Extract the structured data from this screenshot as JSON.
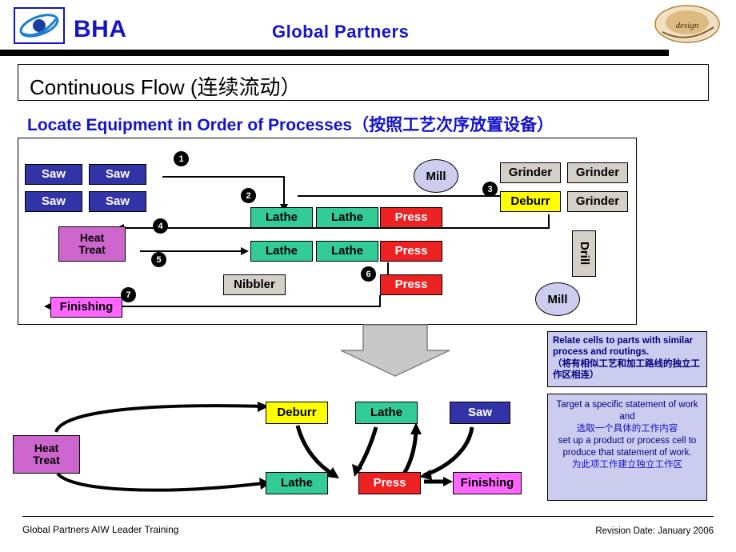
{
  "header": {
    "brand": "BHA",
    "center_title": "Global Partners",
    "logo_icon": "swoosh-logo-icon",
    "right_logo_icon": "company-seal-icon"
  },
  "title": "Continuous Flow (连续流动）",
  "subtitle": "Locate Equipment in Order of Processes（按照工艺次序放置设备）",
  "top_diagram": {
    "nodes": [
      {
        "id": "saw1",
        "label": "Saw",
        "type": "saw"
      },
      {
        "id": "saw2",
        "label": "Saw",
        "type": "saw"
      },
      {
        "id": "saw3",
        "label": "Saw",
        "type": "saw"
      },
      {
        "id": "saw4",
        "label": "Saw",
        "type": "saw"
      },
      {
        "id": "lathe1",
        "label": "Lathe",
        "type": "lathe"
      },
      {
        "id": "lathe2",
        "label": "Lathe",
        "type": "lathe"
      },
      {
        "id": "lathe3",
        "label": "Lathe",
        "type": "lathe"
      },
      {
        "id": "lathe4",
        "label": "Lathe",
        "type": "lathe"
      },
      {
        "id": "press1",
        "label": "Press",
        "type": "press"
      },
      {
        "id": "press2",
        "label": "Press",
        "type": "press"
      },
      {
        "id": "press3",
        "label": "Press",
        "type": "press"
      },
      {
        "id": "mill1",
        "label": "Mill",
        "type": "mill"
      },
      {
        "id": "mill2",
        "label": "Mill",
        "type": "mill"
      },
      {
        "id": "grinder1",
        "label": "Grinder",
        "type": "grinder"
      },
      {
        "id": "grinder2",
        "label": "Grinder",
        "type": "grinder"
      },
      {
        "id": "grinder3",
        "label": "Grinder",
        "type": "grinder"
      },
      {
        "id": "deburr",
        "label": "Deburr",
        "type": "deburr"
      },
      {
        "id": "drill",
        "label": "Drill",
        "type": "drill"
      },
      {
        "id": "nibbler",
        "label": "Nibbler",
        "type": "nibbler"
      },
      {
        "id": "heat",
        "label": "Heat\nTreat",
        "label_line1": "Heat",
        "label_line2": "Treat",
        "type": "heat"
      },
      {
        "id": "finishing",
        "label": "Finishing",
        "type": "finishing"
      }
    ],
    "step_badges": [
      "1",
      "2",
      "3",
      "4",
      "5",
      "6",
      "7"
    ]
  },
  "callouts": {
    "relate": "Relate cells to parts with similar process and routings.（将有相似工艺和加工路线的独立工作区相连）",
    "relate_en": "Relate cells to parts with similar process and routings.",
    "relate_zh": "（将有相似工艺和加工路线的独立工作区相连）",
    "target_en_1": "Target a specific statement of work and",
    "target_zh_1": "选取一个具体的工作内容",
    "target_en_2": "set up a product or process cell to produce that statement of work.",
    "target_zh_2": "为此项工作建立独立工作区"
  },
  "bottom_diagram": {
    "nodes": [
      {
        "id": "heat_b",
        "label_line1": "Heat",
        "label_line2": "Treat",
        "type": "heat"
      },
      {
        "id": "deburr_b",
        "label": "Deburr",
        "type": "deburr"
      },
      {
        "id": "lathe_b1",
        "label": "Lathe",
        "type": "lathe"
      },
      {
        "id": "saw_b",
        "label": "Saw",
        "type": "saw"
      },
      {
        "id": "lathe_b2",
        "label": "Lathe",
        "type": "lathe"
      },
      {
        "id": "press_b",
        "label": "Press",
        "type": "press"
      },
      {
        "id": "finishing_b",
        "label": "Finishing",
        "type": "finishing"
      }
    ]
  },
  "footer": {
    "left": "Global Partners AIW Leader Training",
    "right": "Revision Date:  January 2006"
  },
  "colors": {
    "brand_blue": "#1414c8",
    "saw": "#3333a8",
    "lathe": "#33cc99",
    "press": "#ee2222",
    "deburr": "#ffff00",
    "grey": "#d4d0c8",
    "heat": "#cc66cc",
    "finishing": "#ff66ff",
    "mill": "#ccccee",
    "callout_bg": "#ccccee"
  }
}
